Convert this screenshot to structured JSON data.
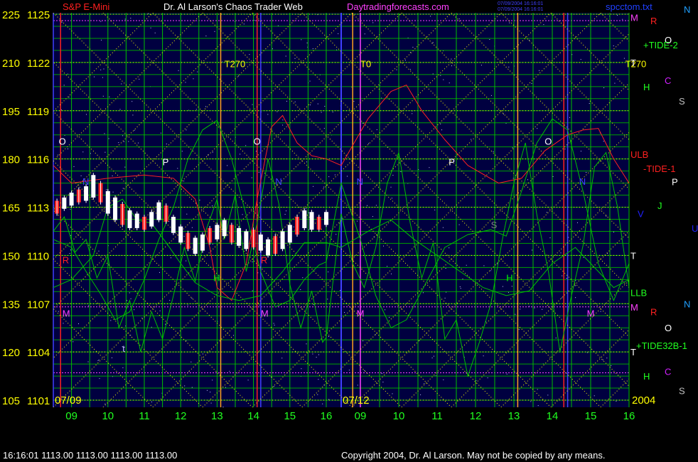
{
  "header": {
    "symbol": "S&P E-Mini",
    "title": "Dr. Al Larson's Chaos Trader Web",
    "site": "Daytradingforecasts.com",
    "stamp1": "07/09/2004 16:16:01",
    "stamp2": "07/09/2004 16:16:01",
    "file": "spcctom.txt"
  },
  "footer": {
    "quote": "16:16:01  1113.00 1113.00 1113.00 1113.00",
    "copyright": "Copyright 2004, Dr. Al Larson. May not be copied by any means."
  },
  "colors": {
    "plot_bg": "#000040",
    "grid_green": "#00c000",
    "yellow": "#ffff00",
    "magenta": "#ff40ff",
    "red": "#ff2020",
    "white": "#ffffff",
    "blue": "#2020ff"
  },
  "chart_data": {
    "type": "line",
    "title": "S&P E-Mini",
    "y_left_labels": [
      "225",
      "210",
      "195",
      "180",
      "165",
      "150",
      "135",
      "120",
      "105"
    ],
    "y_right_labels": [
      "1125",
      "1122",
      "1119",
      "1116",
      "1113",
      "1110",
      "1107",
      "1104",
      "1101"
    ],
    "ylim": [
      1101,
      1125
    ],
    "date_labels": [
      "07/09",
      "07/12",
      "2004"
    ],
    "hour_labels": [
      "09",
      "10",
      "11",
      "12",
      "13",
      "14",
      "15",
      "16",
      "09",
      "10",
      "11",
      "12",
      "13",
      "14",
      "15",
      "16"
    ],
    "days": [
      "07/09",
      "07/12"
    ],
    "hours_per_day": [
      8.5,
      16
    ],
    "price_bars": [
      {
        "x": 8.6,
        "h": 1113.4,
        "l": 1112.6
      },
      {
        "x": 8.8,
        "h": 1113.6,
        "l": 1112.9
      },
      {
        "x": 9.0,
        "h": 1113.9,
        "l": 1113.1
      },
      {
        "x": 9.2,
        "h": 1114.1,
        "l": 1113.3
      },
      {
        "x": 9.4,
        "h": 1114.3,
        "l": 1113.4
      },
      {
        "x": 9.6,
        "h": 1115.0,
        "l": 1113.6
      },
      {
        "x": 9.8,
        "h": 1114.5,
        "l": 1113.3
      },
      {
        "x": 10.0,
        "h": 1114.0,
        "l": 1112.6
      },
      {
        "x": 10.2,
        "h": 1113.6,
        "l": 1112.2
      },
      {
        "x": 10.4,
        "h": 1113.2,
        "l": 1111.9
      },
      {
        "x": 10.6,
        "h": 1112.8,
        "l": 1111.7
      },
      {
        "x": 10.8,
        "h": 1112.6,
        "l": 1111.7
      },
      {
        "x": 11.0,
        "h": 1112.4,
        "l": 1111.6
      },
      {
        "x": 11.2,
        "h": 1112.7,
        "l": 1111.8
      },
      {
        "x": 11.4,
        "h": 1113.3,
        "l": 1112.2
      },
      {
        "x": 11.6,
        "h": 1113.1,
        "l": 1112.1
      },
      {
        "x": 11.8,
        "h": 1112.4,
        "l": 1111.4
      },
      {
        "x": 12.0,
        "h": 1111.8,
        "l": 1110.8
      },
      {
        "x": 12.2,
        "h": 1111.4,
        "l": 1110.4
      },
      {
        "x": 12.4,
        "h": 1111.1,
        "l": 1110.1
      },
      {
        "x": 12.6,
        "h": 1111.3,
        "l": 1110.3
      },
      {
        "x": 12.8,
        "h": 1111.7,
        "l": 1110.8
      },
      {
        "x": 13.0,
        "h": 1111.9,
        "l": 1111.0
      },
      {
        "x": 13.2,
        "h": 1112.2,
        "l": 1111.2
      },
      {
        "x": 13.4,
        "h": 1111.9,
        "l": 1110.8
      },
      {
        "x": 13.6,
        "h": 1111.7,
        "l": 1110.6
      },
      {
        "x": 13.8,
        "h": 1111.5,
        "l": 1110.4
      },
      {
        "x": 14.0,
        "h": 1111.6,
        "l": 1110.5
      },
      {
        "x": 14.2,
        "h": 1111.3,
        "l": 1110.3
      },
      {
        "x": 14.4,
        "h": 1111.0,
        "l": 1110.0
      },
      {
        "x": 14.6,
        "h": 1111.2,
        "l": 1110.1
      },
      {
        "x": 14.8,
        "h": 1111.5,
        "l": 1110.4
      },
      {
        "x": 15.0,
        "h": 1111.9,
        "l": 1110.8
      },
      {
        "x": 15.2,
        "h": 1112.4,
        "l": 1111.3
      },
      {
        "x": 15.4,
        "h": 1112.8,
        "l": 1111.7
      },
      {
        "x": 15.6,
        "h": 1112.7,
        "l": 1111.6
      },
      {
        "x": 15.8,
        "h": 1112.4,
        "l": 1111.6
      },
      {
        "x": 16.0,
        "h": 1112.7,
        "l": 1111.9
      }
    ],
    "line_series": [
      {
        "color": "#ff2020",
        "points": [
          [
            8.5,
            1115.6
          ],
          [
            9.0,
            1114.5
          ],
          [
            10.0,
            1114.8
          ],
          [
            11.0,
            1115.0
          ],
          [
            11.8,
            1114.8
          ],
          [
            12.4,
            1113.5
          ],
          [
            12.8,
            1110.5
          ],
          [
            13.0,
            1108.0
          ],
          [
            13.4,
            1107.2
          ],
          [
            13.8,
            1109.5
          ],
          [
            14.1,
            1113.5
          ],
          [
            14.5,
            1118.0
          ],
          [
            14.8,
            1118.7
          ],
          [
            15.2,
            1117.0
          ],
          [
            15.6,
            1116.2
          ],
          [
            16.0,
            1116.0
          ],
          [
            24.5,
            1115.6
          ],
          [
            25.2,
            1118.5
          ],
          [
            25.8,
            1120.2
          ],
          [
            26.2,
            1120.6
          ],
          [
            26.6,
            1119.0
          ],
          [
            27.2,
            1117.2
          ],
          [
            27.8,
            1115.6
          ],
          [
            28.6,
            1114.5
          ],
          [
            29.2,
            1114.8
          ],
          [
            29.8,
            1116.5
          ],
          [
            30.4,
            1117.5
          ],
          [
            30.8,
            1117.8
          ],
          [
            31.2,
            1117.9
          ],
          [
            31.6,
            1116.0
          ],
          [
            32.0,
            1114.5
          ]
        ]
      },
      {
        "color": "#00c000",
        "points": [
          [
            8.5,
            1111.0
          ],
          [
            9.0,
            1110.5
          ],
          [
            9.4,
            1109.0
          ],
          [
            9.8,
            1107.6
          ],
          [
            10.2,
            1106.0
          ],
          [
            10.6,
            1106.5
          ],
          [
            11.0,
            1108.5
          ],
          [
            11.4,
            1111.0
          ],
          [
            11.8,
            1113.0
          ],
          [
            12.2,
            1116.0
          ],
          [
            12.6,
            1117.8
          ],
          [
            13.0,
            1118.4
          ],
          [
            13.4,
            1116.0
          ],
          [
            13.8,
            1112.5
          ],
          [
            14.2,
            1109.0
          ],
          [
            14.6,
            1106.8
          ],
          [
            15.0,
            1107.2
          ],
          [
            15.4,
            1108.5
          ],
          [
            15.8,
            1109.4
          ],
          [
            16.0,
            1109.6
          ],
          [
            24.5,
            1114.5
          ],
          [
            25.0,
            1111.0
          ],
          [
            25.4,
            1107.5
          ],
          [
            25.8,
            1105.5
          ],
          [
            26.2,
            1106.0
          ],
          [
            26.6,
            1107.8
          ],
          [
            27.2,
            1110.5
          ],
          [
            27.8,
            1111.3
          ],
          [
            28.4,
            1111.6
          ],
          [
            28.8,
            1111.2
          ],
          [
            29.2,
            1114.0
          ],
          [
            29.6,
            1117.0
          ],
          [
            30.0,
            1118.5
          ],
          [
            30.4,
            1117.8
          ],
          [
            30.8,
            1114.0
          ],
          [
            31.2,
            1109.5
          ],
          [
            31.6,
            1107.2
          ],
          [
            32.0,
            1109.5
          ]
        ]
      },
      {
        "color": "#00c000",
        "points": [
          [
            8.5,
            1108.0
          ],
          [
            9.0,
            1108.5
          ],
          [
            9.6,
            1110.0
          ],
          [
            10.0,
            1113.0
          ],
          [
            10.4,
            1113.5
          ],
          [
            10.8,
            1112.2
          ],
          [
            11.2,
            1112.0
          ],
          [
            11.6,
            1110.8
          ],
          [
            12.0,
            1109.5
          ],
          [
            12.4,
            1108.3
          ],
          [
            13.0,
            1107.5
          ],
          [
            13.6,
            1107.2
          ],
          [
            14.2,
            1107.5
          ],
          [
            14.8,
            1109.0
          ],
          [
            15.4,
            1110.8
          ],
          [
            16.0,
            1110.8
          ],
          [
            24.5,
            1110.5
          ],
          [
            25.2,
            1111.5
          ],
          [
            25.8,
            1112.2
          ],
          [
            26.4,
            1111.0
          ],
          [
            27.0,
            1110.0
          ],
          [
            27.6,
            1109.0
          ],
          [
            28.2,
            1108.0
          ],
          [
            28.8,
            1107.5
          ],
          [
            29.4,
            1107.8
          ],
          [
            30.0,
            1109.5
          ],
          [
            30.6,
            1110.5
          ],
          [
            31.2,
            1109.0
          ],
          [
            31.6,
            1108.0
          ],
          [
            32.0,
            1108.5
          ]
        ]
      },
      {
        "color": "#00c000",
        "points": [
          [
            8.5,
            1111.5
          ],
          [
            8.8,
            1112.4
          ],
          [
            9.1,
            1110.2
          ],
          [
            9.4,
            1111.0
          ],
          [
            9.7,
            1108.6
          ],
          [
            10.0,
            1110.0
          ],
          [
            10.3,
            1105.5
          ],
          [
            10.6,
            1107.2
          ],
          [
            10.9,
            1104.0
          ],
          [
            11.2,
            1106.5
          ],
          [
            11.5,
            1104.8
          ],
          [
            11.8,
            1107.5
          ],
          [
            12.1,
            1110.5
          ],
          [
            12.4,
            1108.4
          ],
          [
            12.7,
            1111.6
          ],
          [
            13.0,
            1113.5
          ],
          [
            13.2,
            1111.0
          ],
          [
            13.5,
            1113.8
          ],
          [
            13.8,
            1109.0
          ],
          [
            14.1,
            1112.0
          ],
          [
            14.4,
            1116.0
          ],
          [
            14.7,
            1113.2
          ],
          [
            15.0,
            1108.2
          ],
          [
            15.3,
            1105.5
          ],
          [
            15.6,
            1107.8
          ],
          [
            15.9,
            1104.6
          ],
          [
            16.0,
            1104.9
          ],
          [
            24.5,
            1112.6
          ],
          [
            24.8,
            1109.5
          ],
          [
            25.1,
            1108.0
          ],
          [
            25.4,
            1110.5
          ],
          [
            25.7,
            1114.5
          ],
          [
            26.0,
            1116.4
          ],
          [
            26.3,
            1112.0
          ],
          [
            26.6,
            1108.6
          ],
          [
            26.9,
            1110.8
          ],
          [
            27.2,
            1104.8
          ],
          [
            27.5,
            1106.0
          ],
          [
            27.8,
            1102.5
          ],
          [
            28.1,
            1104.6
          ],
          [
            28.4,
            1107.0
          ],
          [
            28.7,
            1111.0
          ],
          [
            29.0,
            1114.5
          ],
          [
            29.3,
            1117.0
          ],
          [
            29.6,
            1112.5
          ],
          [
            29.9,
            1109.0
          ],
          [
            30.2,
            1104.0
          ],
          [
            30.5,
            1107.5
          ],
          [
            30.8,
            1110.6
          ],
          [
            31.1,
            1115.5
          ],
          [
            31.4,
            1116.4
          ],
          [
            31.7,
            1113.0
          ],
          [
            32.0,
            1108.0
          ]
        ]
      }
    ],
    "annotations": [
      {
        "text": "T270",
        "x": 13.2,
        "y": 1121.7,
        "color": "#ffff00"
      },
      {
        "text": "T0",
        "x": 25.0,
        "y": 1121.7,
        "color": "#ffff00"
      },
      {
        "text": "T270",
        "x": 31.9,
        "y": 1121.7,
        "color": "#ffff00"
      },
      {
        "text": "O",
        "x": 8.65,
        "y": 1116.9,
        "color": "#ffffff"
      },
      {
        "text": "P",
        "x": 11.5,
        "y": 1115.6,
        "color": "#ffffff"
      },
      {
        "text": "N",
        "x": 9.3,
        "y": 1114.4,
        "color": "#4040ff"
      },
      {
        "text": "O",
        "x": 14.0,
        "y": 1116.9,
        "color": "#ffffff"
      },
      {
        "text": "N",
        "x": 14.6,
        "y": 1114.4,
        "color": "#4040ff"
      },
      {
        "text": "N",
        "x": 24.9,
        "y": 1114.4,
        "color": "#4040ff"
      },
      {
        "text": "P",
        "x": 27.3,
        "y": 1115.6,
        "color": "#ffffff"
      },
      {
        "text": "O",
        "x": 29.8,
        "y": 1116.9,
        "color": "#ffffff"
      },
      {
        "text": "N",
        "x": 30.7,
        "y": 1114.4,
        "color": "#4040ff"
      },
      {
        "text": "R",
        "x": 8.75,
        "y": 1109.5,
        "color": "#ff2020"
      },
      {
        "text": "R",
        "x": 14.2,
        "y": 1109.5,
        "color": "#ff2020"
      },
      {
        "text": "H",
        "x": 12.9,
        "y": 1108.4,
        "color": "#00ff00"
      },
      {
        "text": "H",
        "x": 28.8,
        "y": 1108.4,
        "color": "#00ff00"
      },
      {
        "text": "M",
        "x": 8.75,
        "y": 1106.2,
        "color": "#ff40ff"
      },
      {
        "text": "M",
        "x": 14.2,
        "y": 1106.2,
        "color": "#ff40ff"
      },
      {
        "text": "M",
        "x": 24.9,
        "y": 1106.2,
        "color": "#ff40ff"
      },
      {
        "text": "M",
        "x": 30.9,
        "y": 1106.2,
        "color": "#ff40ff"
      },
      {
        "text": "t",
        "x": 10.4,
        "y": 1104.0,
        "color": "#c0c0ff"
      },
      {
        "text": "S",
        "x": 28.4,
        "y": 1111.7,
        "color": "#808080"
      }
    ],
    "right_labels": [
      {
        "text": "M",
        "y": 1124.8,
        "color": "#ff40ff",
        "dx": 0
      },
      {
        "text": "R",
        "y": 1124.6,
        "color": "#ff2020",
        "dx": 28
      },
      {
        "text": "N",
        "y": 1125.3,
        "color": "#20a0ff",
        "dx": 75
      },
      {
        "text": "O",
        "y": 1123.4,
        "color": "#ffffff",
        "dx": 48
      },
      {
        "text": "+TIDE-2",
        "y": 1123.1,
        "color": "#20ff20",
        "dx": 18
      },
      {
        "text": "T",
        "y": 1122.0,
        "color": "#ffffff",
        "dx": 0
      },
      {
        "text": "H",
        "y": 1120.5,
        "color": "#20ff20",
        "dx": 18
      },
      {
        "text": "C",
        "y": 1120.9,
        "color": "#d020ff",
        "dx": 48
      },
      {
        "text": "S",
        "y": 1119.6,
        "color": "#c0c0c0",
        "dx": 68
      },
      {
        "text": "ULB",
        "y": 1116.3,
        "color": "#ff2020",
        "dx": 0
      },
      {
        "text": "-TIDE-1",
        "y": 1115.4,
        "color": "#ff2020",
        "dx": 18
      },
      {
        "text": "P",
        "y": 1114.6,
        "color": "#ffffff",
        "dx": 58
      },
      {
        "text": "J",
        "y": 1113.1,
        "color": "#20ff20",
        "dx": 38
      },
      {
        "text": "V",
        "y": 1112.6,
        "color": "#2020ff",
        "dx": 10
      },
      {
        "text": "U",
        "y": 1111.7,
        "color": "#2020ff",
        "dx": 86
      },
      {
        "text": "T",
        "y": 1110.0,
        "color": "#ffffff",
        "dx": 0
      },
      {
        "text": "LLB",
        "y": 1107.7,
        "color": "#20ff20",
        "dx": 0
      },
      {
        "text": "M",
        "y": 1106.8,
        "color": "#ff40ff",
        "dx": 0
      },
      {
        "text": "R",
        "y": 1106.5,
        "color": "#ff2020",
        "dx": 28
      },
      {
        "text": "N",
        "y": 1107.0,
        "color": "#20a0ff",
        "dx": 75
      },
      {
        "text": "O",
        "y": 1105.5,
        "color": "#ffffff",
        "dx": 48
      },
      {
        "text": "+TIDE32B-1",
        "y": 1104.4,
        "color": "#20ff20",
        "dx": 8
      },
      {
        "text": "T",
        "y": 1104.0,
        "color": "#ffffff",
        "dx": 0
      },
      {
        "text": "H",
        "y": 1102.5,
        "color": "#20ff20",
        "dx": 18
      },
      {
        "text": "C",
        "y": 1102.8,
        "color": "#d020ff",
        "dx": 48
      },
      {
        "text": "S",
        "y": 1101.6,
        "color": "#c0c0c0",
        "dx": 68
      }
    ]
  }
}
